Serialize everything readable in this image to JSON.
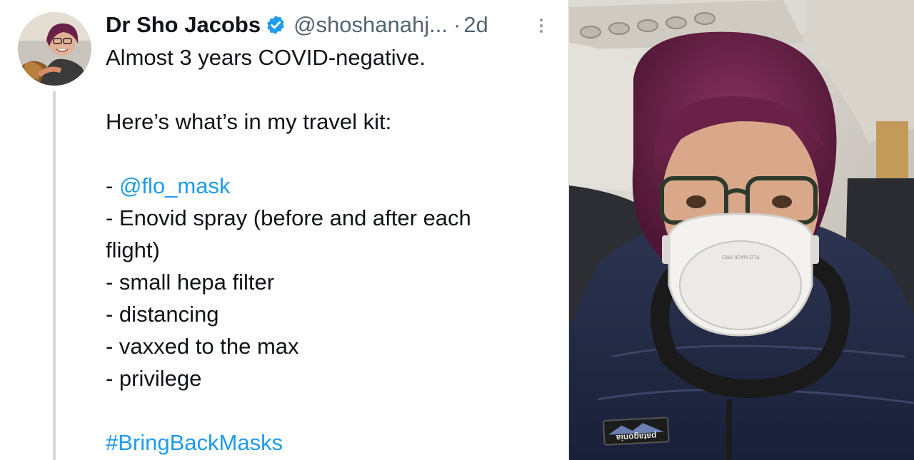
{
  "tweet": {
    "display_name": "Dr Sho Jacobs",
    "handle": "@shoshanahj...",
    "separator": "·",
    "time": "2d",
    "verified": true,
    "lines": {
      "l1": "Almost 3 years COVID-negative.",
      "l3": "Here’s what’s in my travel kit:",
      "l5_prefix": "- ",
      "l5_mention": "@flo_mask",
      "l6": "- Enovid spray (before and after each",
      "l7": "flight)",
      "l8": "- small hepa filter",
      "l9": "- distancing",
      "l10": "- vaxxed to the max",
      "l11": "- privilege",
      "l13_hashtag": "#BringBackMasks"
    }
  },
  "photo": {
    "mask_text": "FLO MASK PRO",
    "jacket_logo": "patagonia"
  },
  "icons": {
    "verified": "verified-badge-icon",
    "more": "more-options-icon"
  },
  "colors": {
    "link": "#1d9bf0",
    "text": "#0f1419",
    "secondary": "#536471",
    "thread_line": "#cfd9de",
    "hair": "#6a2147"
  }
}
